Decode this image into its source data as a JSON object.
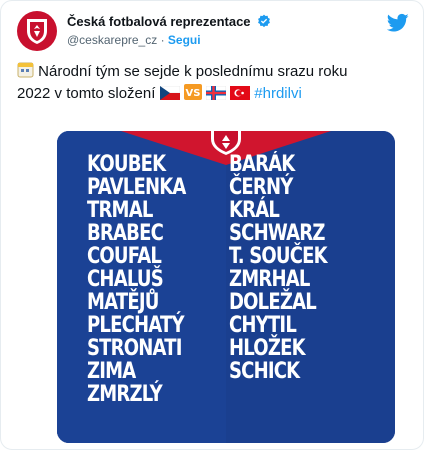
{
  "account": {
    "display_name": "Česká fotbalová reprezentace",
    "handle": "@ceskarepre_cz",
    "separator": "·",
    "follow_label": "Segui"
  },
  "tweet": {
    "line1": "Národní tým se sejde k poslednímu srazu roku",
    "line2_text": "2022 v tomto složení",
    "hashtag": "#hrdilvi"
  },
  "image": {
    "left_column": [
      "KOUBEK",
      "PAVLENKA",
      "TRMAL",
      "BRABEC",
      "COUFAL",
      "CHALUŠ",
      "MATĚJŮ",
      "PLECHATÝ",
      "STRONATI",
      "ZIMA",
      "ZMRZLÝ"
    ],
    "right_column": [
      "BARÁK",
      "ČERNÝ",
      "KRÁL",
      "SCHWARZ",
      "T. SOUČEK",
      "ZMRHAL",
      "DOLEŽAL",
      "CHYTIL",
      "HLOŽEK",
      "SCHICK"
    ]
  },
  "colors": {
    "accent": "#1d9bf0",
    "media_bg": "#1a3f8f",
    "brand_red": "#c8102e"
  },
  "icons": [
    "verified-badge-icon",
    "twitter-bird-icon",
    "calendar-emoji",
    "czech-flag-emoji",
    "vs-emoji",
    "faroe-flag-emoji",
    "turkey-flag-emoji"
  ]
}
